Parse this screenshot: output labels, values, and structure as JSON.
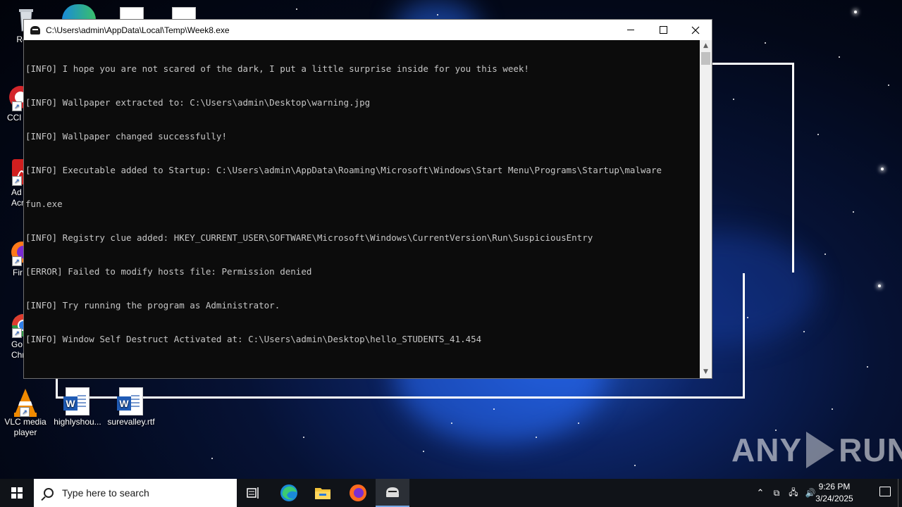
{
  "window": {
    "title": "C:\\Users\\admin\\AppData\\Local\\Temp\\Week8.exe",
    "console_lines": [
      "[INFO] I hope you are not scared of the dark, I put a little surprise inside for you this week!",
      "[INFO] Wallpaper extracted to: C:\\Users\\admin\\Desktop\\warning.jpg",
      "[INFO] Wallpaper changed successfully!",
      "[INFO] Executable added to Startup: C:\\Users\\admin\\AppData\\Roaming\\Microsoft\\Windows\\Start Menu\\Programs\\Startup\\malware",
      "fun.exe",
      "[INFO] Registry clue added: HKEY_CURRENT_USER\\SOFTWARE\\Microsoft\\Windows\\CurrentVersion\\Run\\SuspiciousEntry",
      "[ERROR] Failed to modify hosts file: Permission denied",
      "[INFO] Try running the program as Administrator.",
      "[INFO] Window Self Destruct Activated at: C:\\Users\\admin\\Desktop\\hello_STUDENTS_41.454"
    ]
  },
  "desktop_icons": [
    {
      "label": "Recy",
      "icon": "recycle-bin-icon"
    },
    {
      "label": "CCl",
      "icon": "ccleaner-icon"
    },
    {
      "label": "Ad\nAcr",
      "icon": "acrobat-icon"
    },
    {
      "label": "Fir",
      "icon": "firefox-icon"
    },
    {
      "label": "Go\nChr",
      "icon": "chrome-icon"
    },
    {
      "label": "VLC media\nplayer",
      "icon": "vlc-icon"
    },
    {
      "label": "highlyshou...",
      "icon": "word-document-icon"
    },
    {
      "label": "surevalley.rtf",
      "icon": "word-document-icon"
    }
  ],
  "taskbar": {
    "search_placeholder": "Type here to search",
    "time": "9:26 PM",
    "date": "3/24/2025",
    "apps": [
      "task-view-icon",
      "edge-icon",
      "file-explorer-icon",
      "firefox-icon",
      "console-app-icon"
    ]
  },
  "watermark": {
    "left": "ANY",
    "right": "RUN"
  }
}
